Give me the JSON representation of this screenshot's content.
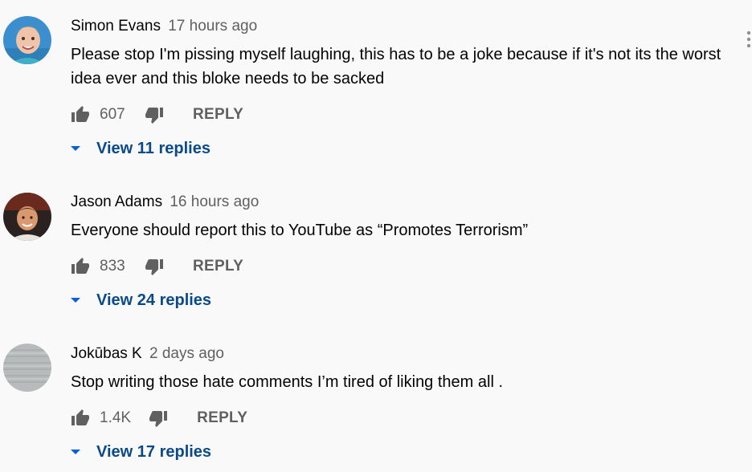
{
  "comments": [
    {
      "author": "Simon Evans",
      "time": "17 hours ago",
      "text": "Please stop I'm pissing myself laughing, this has to be a joke because if it's not its the worst idea ever and this bloke needs to be sacked",
      "likes": "607",
      "reply_label": "REPLY",
      "replies_label": "View 11 replies",
      "avatar_icon": "child-photo-avatar",
      "avatar_color": "#3a8ec7"
    },
    {
      "author": "Jason Adams",
      "time": "16 hours ago",
      "text": "Everyone should report this to YouTube as “Promotes Terrorism”",
      "likes": "833",
      "reply_label": "REPLY",
      "replies_label": "View 24 replies",
      "avatar_icon": "man-photo-avatar",
      "avatar_color": "#5a3a2a"
    },
    {
      "author": "Jokūbas K",
      "time": "2 days ago",
      "text": "Stop writing those hate comments I’m tired of liking them all .",
      "likes": "1.4K",
      "reply_label": "REPLY",
      "replies_label": "View 17 replies",
      "avatar_icon": "grey-static-avatar",
      "avatar_color": "#b8bcbc"
    }
  ],
  "menu_icon": "kebab-menu-icon",
  "colors": {
    "background": "#f9f9f9",
    "link": "#0b4a8a",
    "muted": "#606060"
  }
}
